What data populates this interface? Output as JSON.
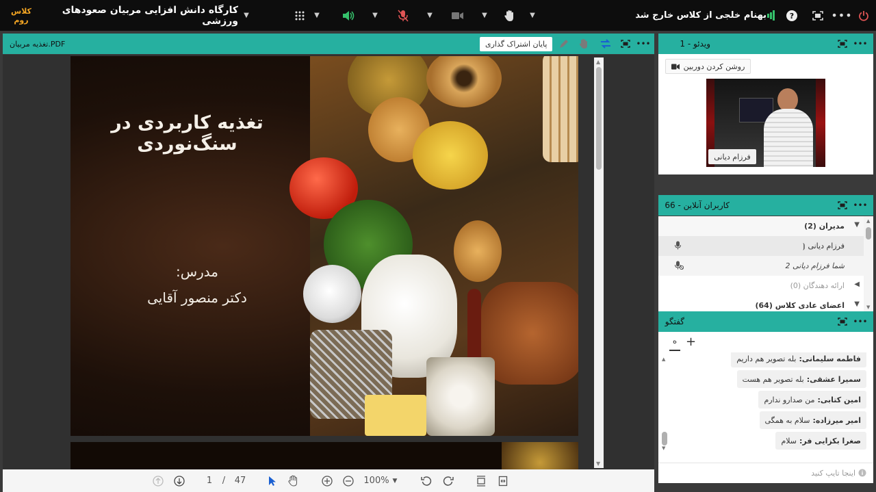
{
  "colors": {
    "accent": "#26b0a0",
    "topbar": "#0d0d0d",
    "logo": "#f5a623",
    "speaker": "#35c06b",
    "mic_muted": "#e05555"
  },
  "topbar": {
    "logo_line1": "كلاس",
    "logo_line2": "روم",
    "room_title": "کارگاه دانش افزایی مربیان صعودهای ورزشی",
    "status_message": "بهنام خلجی از کلاس خارج شد",
    "icons": [
      "chevron-down-icon",
      "grid-icon",
      "speaker-icon",
      "mic-muted-icon",
      "camera-icon",
      "raise-hand-icon",
      "signal-icon",
      "help-icon",
      "fullscreen-icon",
      "more-icon",
      "power-icon"
    ]
  },
  "document_panel": {
    "file_name": "تغذیه مربیان.PDF",
    "end_share_label": "پایان اشتراک گذاری"
  },
  "slide": {
    "title": "تغذیه کاربردی در سنگ‌نوردی",
    "teacher_label": "مدرس:",
    "teacher_name": "دکتر منصور آقایی"
  },
  "pager": {
    "current_page": "1",
    "separator": "/",
    "total_pages": "47",
    "zoom": "100%"
  },
  "video_panel": {
    "title": "ویدئو - 1",
    "camera_button": "روشن کردن دوربین",
    "speaker_name": "فرزام دیانی"
  },
  "users_panel": {
    "title": "کاربران آنلاین - 66",
    "groups": [
      {
        "label": "مدیران (2)"
      },
      {
        "label": "ارائه دهندگان (0)"
      },
      {
        "label": "اعضای عادی کلاس (64)"
      }
    ],
    "admins": [
      {
        "name": "فرزام دیانی"
      },
      {
        "name": "شما  فرزام دیانی 2"
      }
    ]
  },
  "chat_panel": {
    "title": "گفتگو",
    "tab_label": "ه",
    "messages": [
      {
        "sender": "فاطمه سلیمانی:",
        "text": "بله تصویر هم داریم"
      },
      {
        "sender": "سمیرا عشقی:",
        "text": "بله تصویر هم هست"
      },
      {
        "sender": "امین کتابی:",
        "text": "من صدارو ندارم"
      },
      {
        "sender": "امیر میرزاده:",
        "text": "سلام به همگی"
      },
      {
        "sender": "صغرا بکزایی فر:",
        "text": "سلام"
      }
    ],
    "input_placeholder": "اینجا تایپ کنید"
  }
}
